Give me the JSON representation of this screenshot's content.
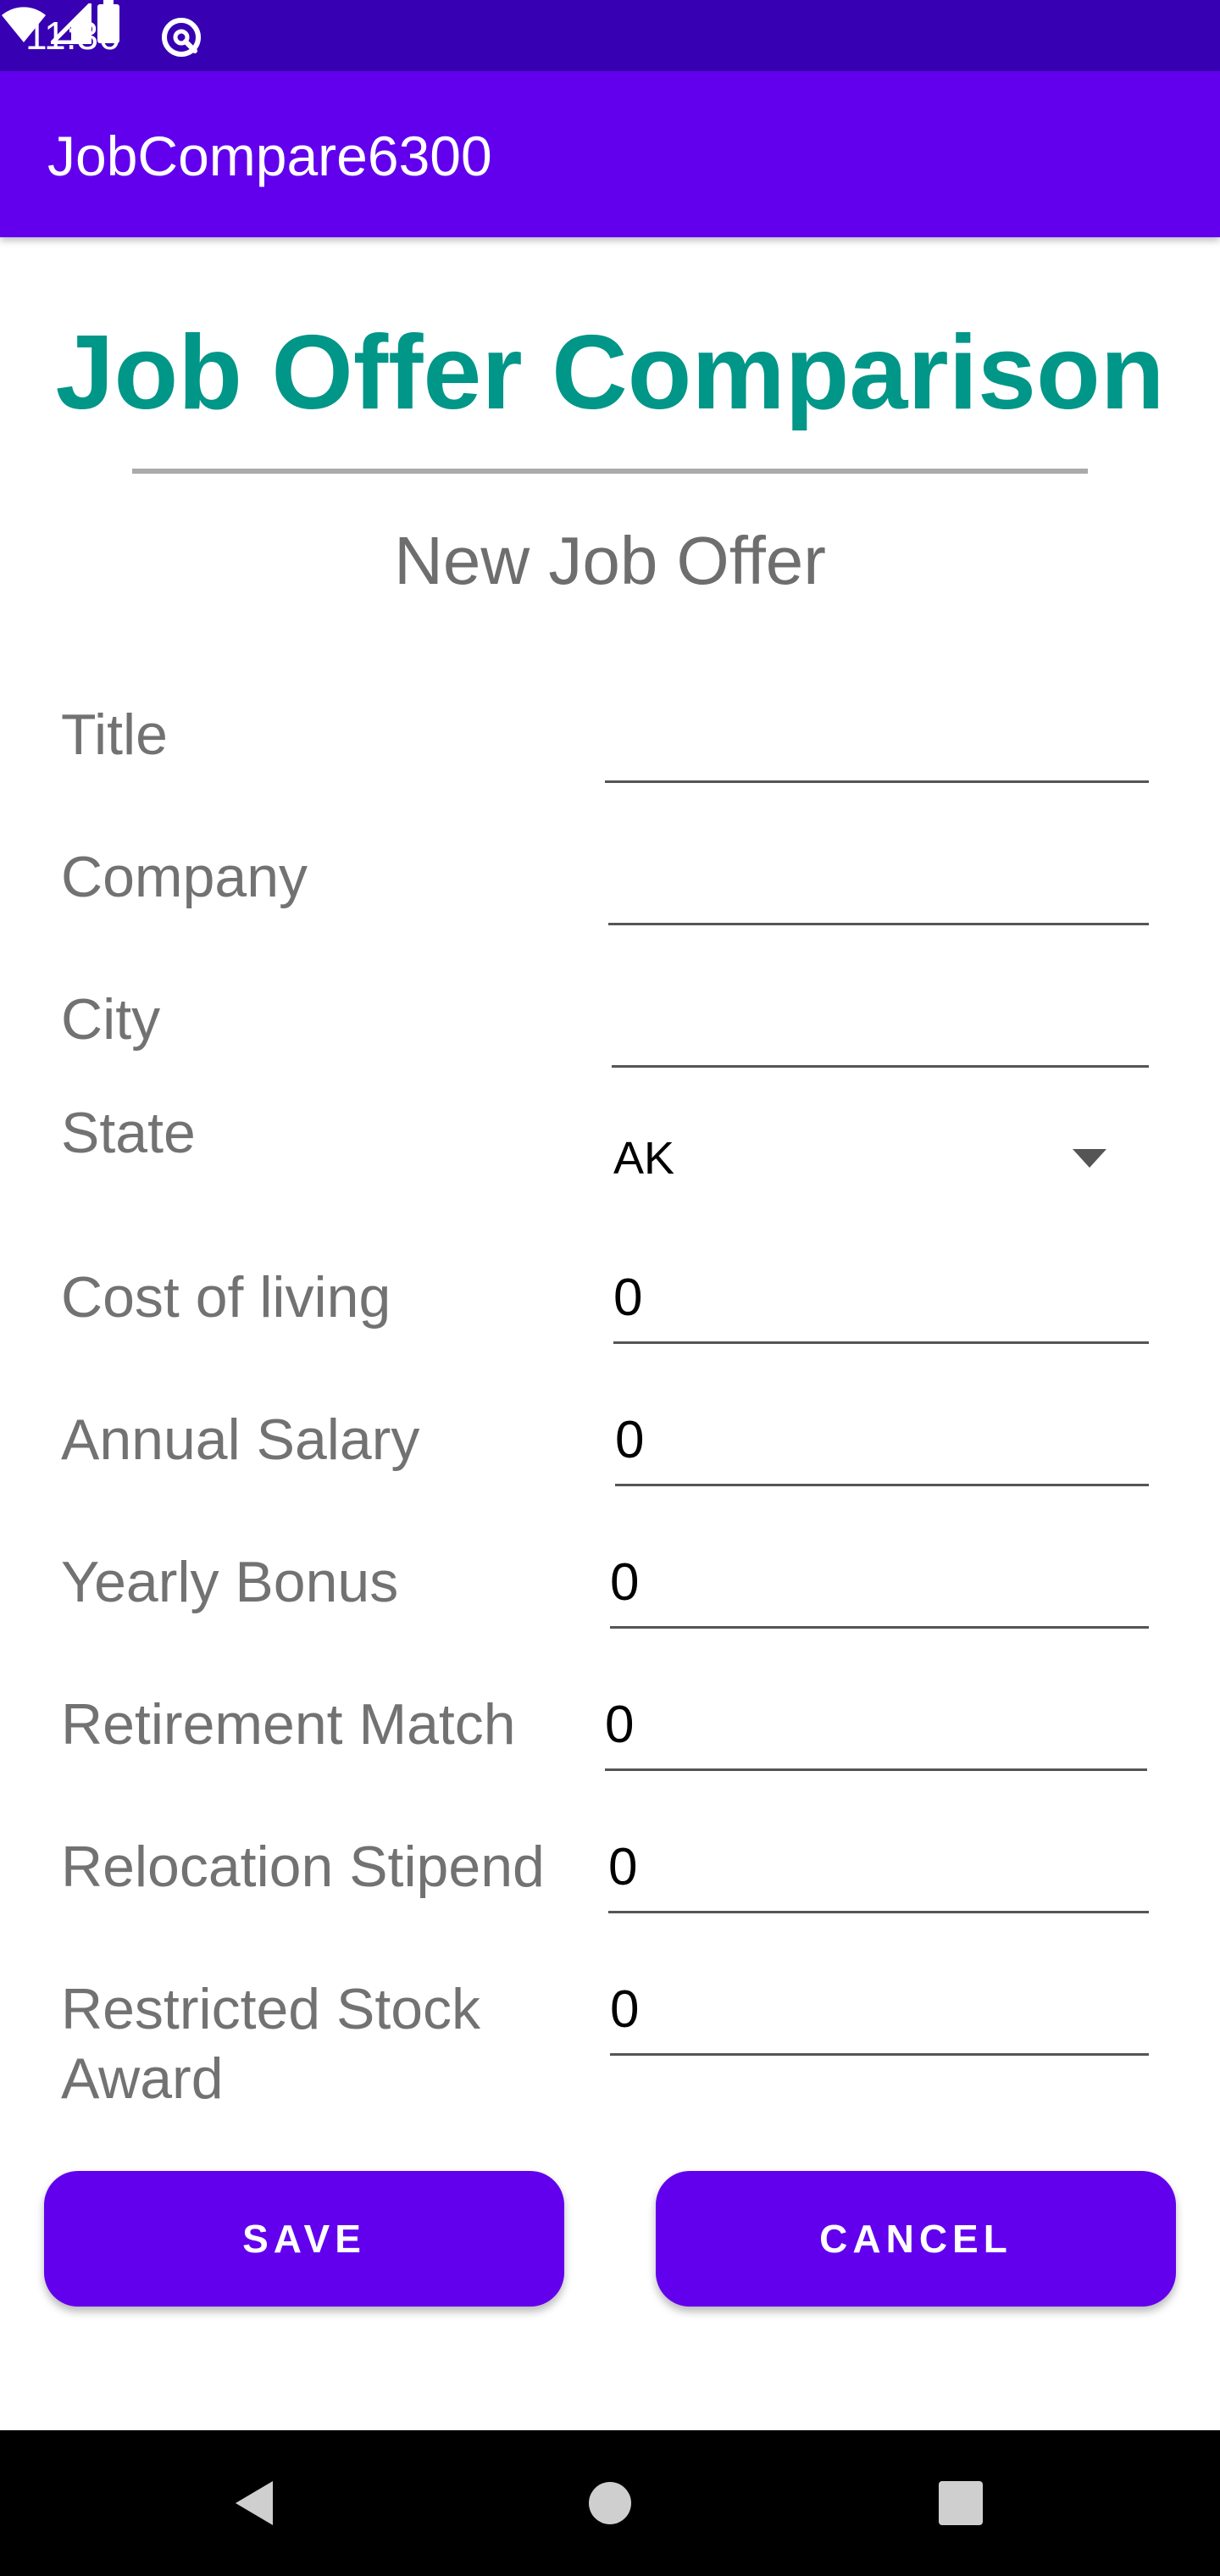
{
  "status_bar": {
    "time": "11:36",
    "app_icon": "at-sign-icon",
    "icons": [
      "wifi-icon",
      "cell-signal-icon",
      "battery-icon"
    ]
  },
  "app_bar": {
    "title": "JobCompare6300"
  },
  "header": {
    "title": "Job Offer Comparison",
    "subtitle": "New Job Offer"
  },
  "form": {
    "title_field": {
      "label": "Title",
      "value": ""
    },
    "company_field": {
      "label": "Company",
      "value": ""
    },
    "city_field": {
      "label": "City",
      "value": ""
    },
    "state_field": {
      "label": "State",
      "selected": "AK",
      "icon": "dropdown-arrow-icon"
    },
    "cost_of_living": {
      "label": "Cost of living",
      "value": "0"
    },
    "annual_salary": {
      "label": "Annual Salary",
      "value": "0"
    },
    "yearly_bonus": {
      "label": "Yearly Bonus",
      "value": "0"
    },
    "retirement_match": {
      "label": "Retirement Match",
      "value": "0"
    },
    "relocation_stipend": {
      "label": "Relocation Stipend",
      "value": "0"
    },
    "restricted_stock": {
      "label_line1": "Restricted Stock",
      "label_line2": "Award",
      "value": "0"
    }
  },
  "actions": {
    "save_label": "SAVE",
    "cancel_label": "CANCEL"
  },
  "nav_bar": {
    "icons": [
      "back-icon",
      "home-icon",
      "recents-icon"
    ]
  },
  "colors": {
    "status_bar": "#3700b3",
    "app_bar": "#6200ee",
    "accent_title": "#009688",
    "button": "#6200ee"
  }
}
